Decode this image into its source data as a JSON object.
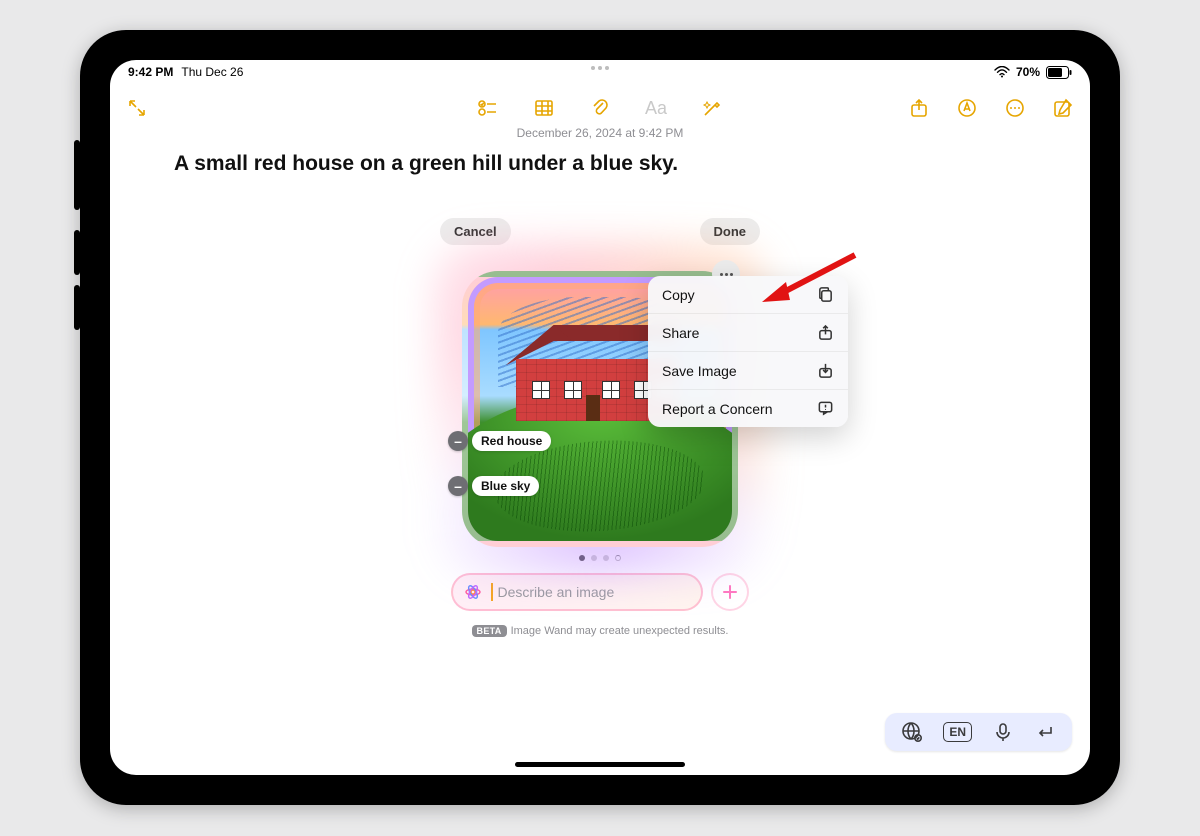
{
  "status": {
    "time": "9:42 PM",
    "date": "Thu Dec 26",
    "battery_pct": "70%"
  },
  "note": {
    "date_line": "December 26, 2024 at 9:42 PM",
    "title": "A small red house on a green hill under a blue sky."
  },
  "wand": {
    "cancel": "Cancel",
    "done": "Done",
    "tags": {
      "red_house": "Red house",
      "blue_sky": "Blue sky"
    },
    "placeholder": "Describe an image",
    "beta_badge": "BETA",
    "disclaimer": "Image Wand may create unexpected results."
  },
  "menu": {
    "copy": "Copy",
    "share": "Share",
    "save_image": "Save Image",
    "report": "Report a Concern"
  },
  "keyboard": {
    "lang": "EN"
  },
  "icons": {
    "collapse": "collapse",
    "checklist": "checklist",
    "table": "table",
    "attach": "attach",
    "format": "Aa",
    "wand": "wand",
    "share": "share",
    "markup": "markup",
    "more": "more",
    "compose": "compose",
    "globe": "globe",
    "mic": "mic",
    "enter": "enter"
  },
  "colors": {
    "accent": "#e6a500",
    "annotation": "#e11313"
  }
}
